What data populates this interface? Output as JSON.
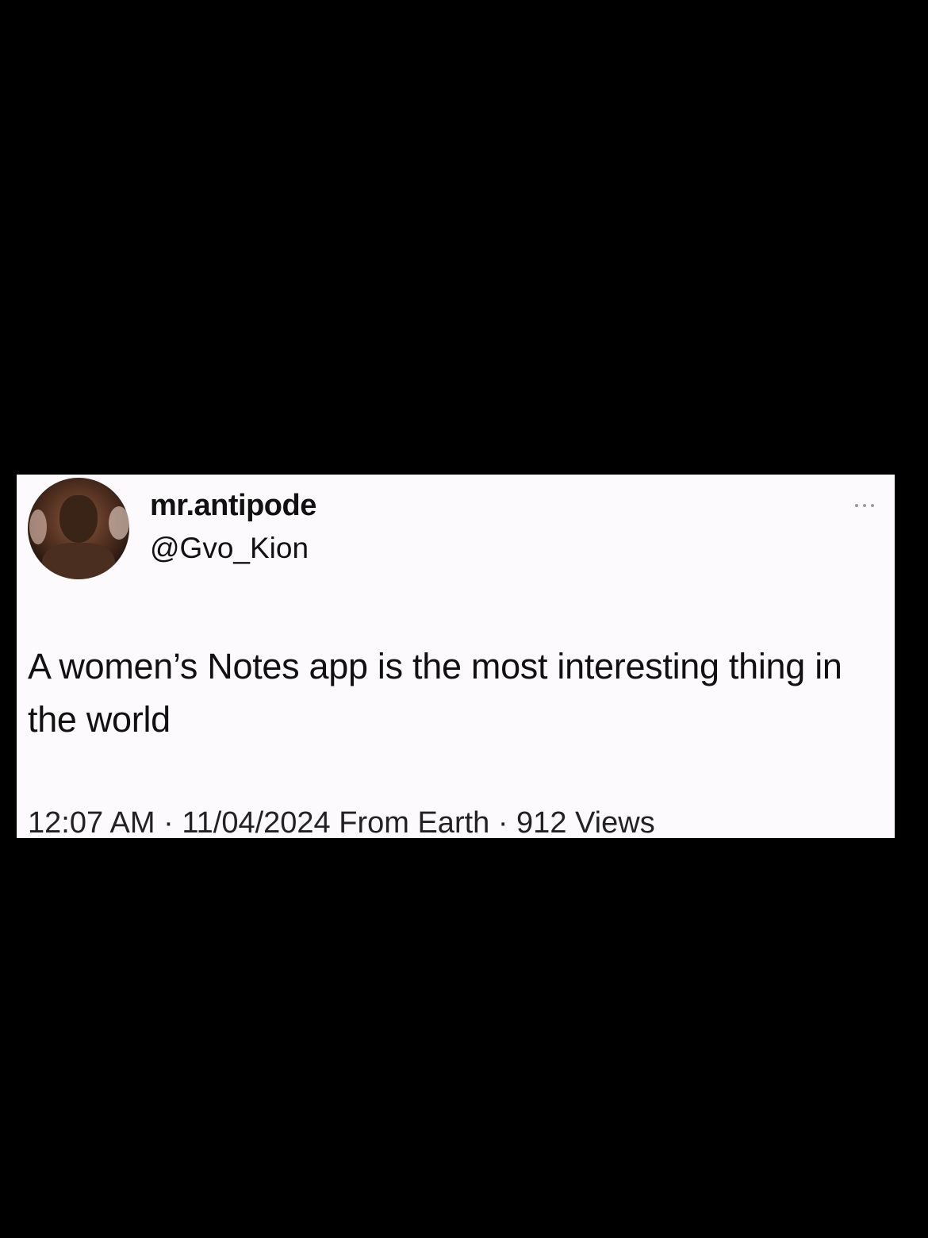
{
  "tweet": {
    "display_name": "mr.antipode",
    "handle": "@Gvo_Kion",
    "text": "A women’s Notes app is the most interesting thing in the world",
    "meta": "12:07 AM · 11/04/2024 From Earth · 912 Views",
    "menu_icon": "more-dots-icon",
    "avatar": "avatar-photo"
  },
  "colors": {
    "page_background": "#000000",
    "card_background": "#fdfafd",
    "text": "#111111"
  }
}
